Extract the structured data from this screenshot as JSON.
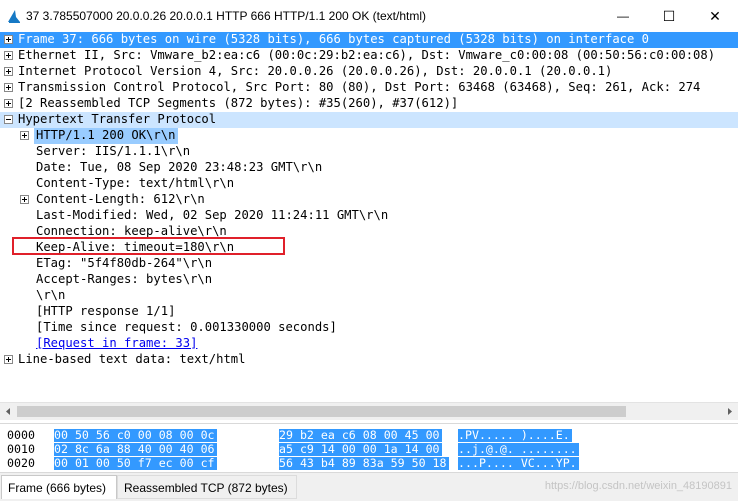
{
  "window": {
    "title": "37 3.785507000 20.0.0.26 20.0.0.1 HTTP 666 HTTP/1.1 200 OK  (text/html)",
    "minimize_glyph": "—",
    "maximize_glyph": "☐",
    "close_glyph": "✕"
  },
  "tree": {
    "frame": "Frame 37: 666 bytes on wire (5328 bits), 666 bytes captured (5328 bits) on interface 0",
    "ethernet": "Ethernet II, Src: Vmware_b2:ea:c6 (00:0c:29:b2:ea:c6), Dst: Vmware_c0:00:08 (00:50:56:c0:00:08)",
    "ip": "Internet Protocol Version 4, Src: 20.0.0.26 (20.0.0.26), Dst: 20.0.0.1 (20.0.0.1)",
    "tcp": "Transmission Control Protocol, Src Port: 80 (80), Dst Port: 63468 (63468), Seq: 261, Ack: 274",
    "reassembled": "[2 Reassembled TCP Segments (872 bytes): #35(260), #37(612)]",
    "http": "Hypertext Transfer Protocol",
    "status_line": "HTTP/1.1 200 OK\\r\\n",
    "server": "Server: IIS/1.1.1\\r\\n",
    "date": "Date: Tue, 08 Sep 2020 23:48:23 GMT\\r\\n",
    "content_type": "Content-Type: text/html\\r\\n",
    "content_length": "Content-Length: 612\\r\\n",
    "last_modified": "Last-Modified: Wed, 02 Sep 2020 11:24:11 GMT\\r\\n",
    "connection": "Connection: keep-alive\\r\\n",
    "keep_alive": "Keep-Alive: timeout=180\\r\\n",
    "etag": "ETag: \"5f4f80db-264\"\\r\\n",
    "accept_ranges": "Accept-Ranges: bytes\\r\\n",
    "crlf": "\\r\\n",
    "http_response": "[HTTP response 1/1]",
    "time_since": "[Time since request: 0.001330000 seconds]",
    "request_in_frame": "[Request in frame: 33]",
    "line_based": "Line-based text data: text/html"
  },
  "bytes": {
    "rows": [
      {
        "offset": "0000",
        "hex1": "00 50 56 c0 00 08 00 0c",
        "hex2": "29 b2 ea c6 08 00 45 00",
        "ascii": ".PV..... )....E."
      },
      {
        "offset": "0010",
        "hex1": "02 8c 6a 88 40 00 40 06",
        "hex2": "a5 c9 14 00 00 1a 14 00",
        "ascii": "..j.@.@. ........"
      },
      {
        "offset": "0020",
        "hex1": "00 01 00 50 f7 ec 00 cf",
        "hex2": "56 43 b4 89 83a 59 50 18",
        "ascii": "...P.... VC...YP."
      }
    ]
  },
  "tabs": {
    "frame": "Frame (666 bytes)",
    "reassembled": "Reassembled TCP (872 bytes)"
  },
  "watermark": "https://blog.csdn.net/weixin_48190891"
}
